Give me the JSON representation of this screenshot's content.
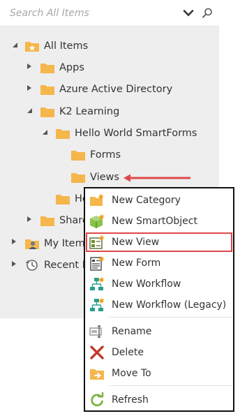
{
  "search": {
    "placeholder": "Search All Items"
  },
  "tree": {
    "all_items": "All Items",
    "apps": "Apps",
    "azure_ad": "Azure Active Directory",
    "k2_learning": "K2 Learning",
    "hello_world_smartforms": "Hello World SmartForms",
    "forms": "Forms",
    "views": "Views",
    "hello_truncated": "He",
    "shared_truncated": "Share",
    "my_items": "My Items",
    "recent_items": "Recent It"
  },
  "context_menu": {
    "new_category": "New Category",
    "new_smartobject": "New SmartObject",
    "new_view": "New View",
    "new_form": "New Form",
    "new_workflow": "New Workflow",
    "new_workflow_legacy": "New Workflow (Legacy)",
    "rename": "Rename",
    "delete": "Delete",
    "move_to": "Move To",
    "refresh": "Refresh"
  },
  "colors": {
    "folder": "#f5b64c",
    "tree_background": "#eeeeee",
    "highlight": "#e04848",
    "arrow": "#e04848",
    "delete": "#c0392b",
    "refresh": "#7cb342",
    "workflow": "#2a9d8f"
  },
  "icons": {
    "search": "search-icon",
    "dropdown": "chevron-down-icon",
    "folder": "folder-icon",
    "star_folder": "star-folder-icon",
    "user": "user-icon",
    "recent": "clock-icon"
  }
}
